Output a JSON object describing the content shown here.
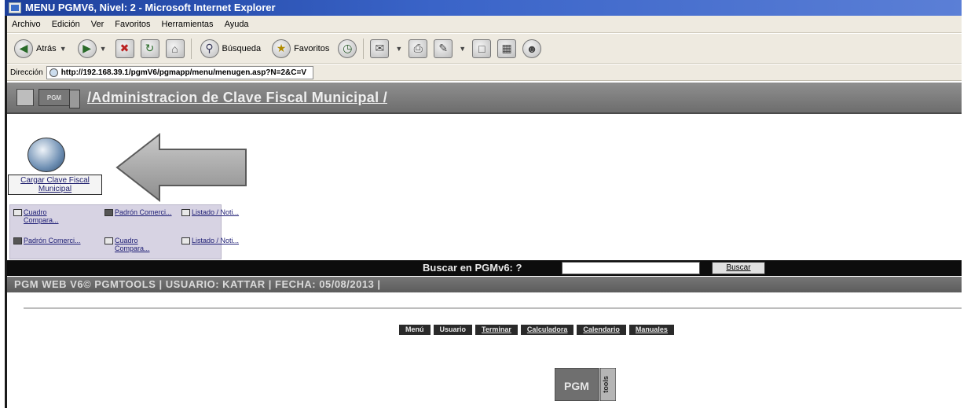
{
  "window": {
    "title": "MENU PGMV6, Nivel: 2 - Microsoft Internet Explorer"
  },
  "menubar": {
    "items": [
      "Archivo",
      "Edición",
      "Ver",
      "Favoritos",
      "Herramientas",
      "Ayuda"
    ]
  },
  "toolbar": {
    "back": "Atrás",
    "search": "Búsqueda",
    "favorites": "Favoritos"
  },
  "address": {
    "label": "Dirección",
    "url": "http://192.168.39.1/pgmV6/pgmapp/menu/menugen.asp?N=2&C=V"
  },
  "header": {
    "title": "/Administracion de Clave Fiscal Municipal /",
    "logo": "PGM"
  },
  "module": {
    "label": "Cargar Clave Fiscal Municipal"
  },
  "shortcuts": [
    {
      "label": "Cuadro Compara..."
    },
    {
      "label": "Padrón Comerci..."
    },
    {
      "label": "Listado / Noti..."
    },
    {
      "label": "Padrón Comerci..."
    },
    {
      "label": "Cuadro Compara..."
    },
    {
      "label": "Listado / Noti..."
    }
  ],
  "search": {
    "label": "Buscar en PGMv6: ?",
    "button": "Buscar",
    "value": ""
  },
  "status": {
    "text": "PGM WEB V6© PGMTOOLS  | USUARIO: KATTAR | FECHA: 05/08/2013 |"
  },
  "footer_nav": [
    "Menú",
    "Usuario",
    "Terminar",
    "Calculadora",
    "Calendario",
    "Manuales"
  ],
  "logo": {
    "text": "PGM",
    "side": "tools"
  },
  "colors": {
    "accent": "#1c3f9b",
    "header_band": "#7a7a7a",
    "search_band": "#0d0d0d",
    "grid_bg": "#d7d3e3"
  }
}
